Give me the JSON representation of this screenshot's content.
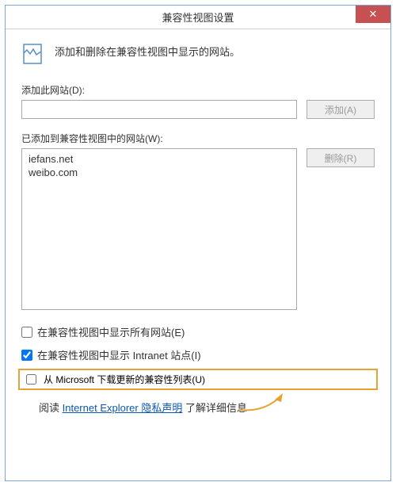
{
  "window": {
    "title": "兼容性视图设置",
    "close_label": "✕"
  },
  "header": {
    "description": "添加和删除在兼容性视图中显示的网站。"
  },
  "add_section": {
    "label": "添加此网站(D):",
    "input_value": "",
    "add_button": "添加(A)"
  },
  "list_section": {
    "label": "已添加到兼容性视图中的网站(W):",
    "items": [
      "iefans.net",
      "weibo.com"
    ],
    "remove_button": "删除(R)"
  },
  "checkboxes": {
    "display_all": {
      "label": "在兼容性视图中显示所有网站(E)",
      "checked": false
    },
    "display_intranet": {
      "label": "在兼容性视图中显示 Intranet 站点(I)",
      "checked": true
    },
    "download_list": {
      "label": "从 Microsoft 下载更新的兼容性列表(U)",
      "checked": false
    }
  },
  "footer": {
    "prefix": "阅读 ",
    "link": "Internet Explorer 隐私声明",
    "suffix": " 了解详细信息"
  },
  "colors": {
    "border": "#7ca8d8",
    "close": "#c75050",
    "highlight": "#e6a334",
    "link": "#0b57b5"
  }
}
